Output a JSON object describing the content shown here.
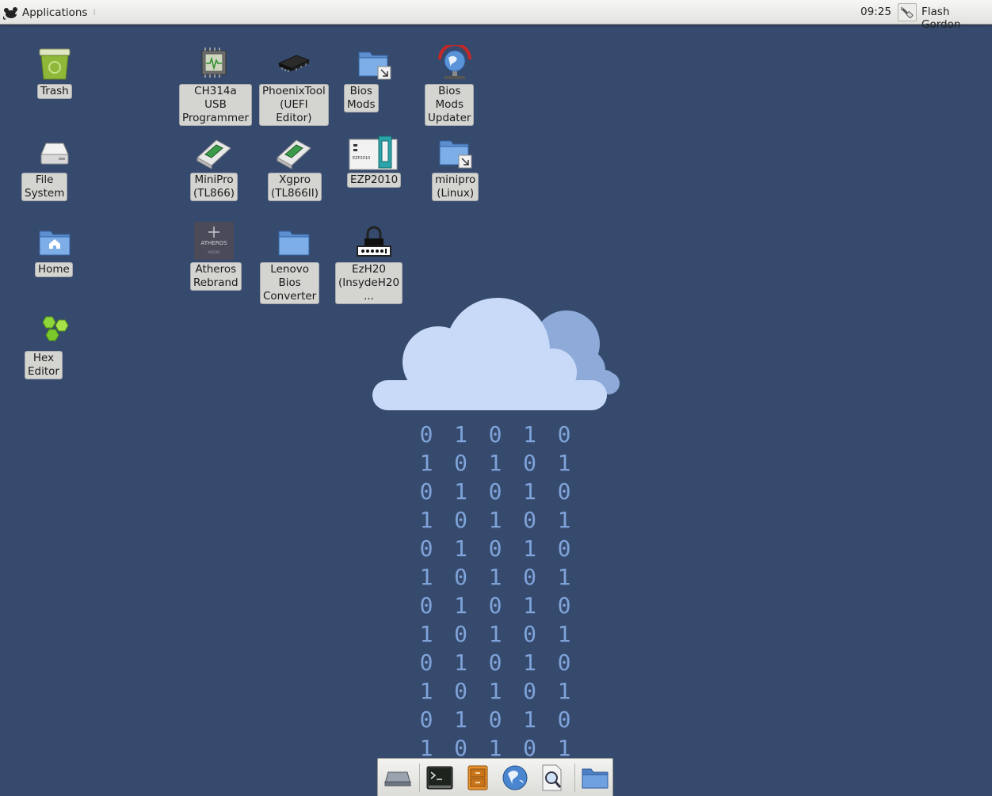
{
  "panel": {
    "applications_label": "Applications",
    "clock": "09:25",
    "user_name": "Flash Gordon"
  },
  "desktop": {
    "trash": "Trash",
    "file_system": "File System",
    "home": "Home",
    "hex_editor": "Hex Editor",
    "ch314a": "CH314a USB\nProgrammer",
    "phoenixtool": "PhoenixTool\n(UEFI Editor)",
    "bios_mods": "Bios Mods",
    "bios_mods_updater": "Bios Mods\nUpdater",
    "minipro_tl866": "MiniPro\n(TL866)",
    "xgpro": "Xgpro\n(TL866II)",
    "ezp2010": "EZP2010",
    "minipro_linux": "minipro\n(Linux)",
    "atheros": "Atheros\nRebrand",
    "lenovo": "Lenovo Bios\nConverter",
    "ezh20": "EzH20\n(InsydeH20 ..."
  },
  "wallpaper": {
    "rows": [
      [
        "0",
        "1",
        "0",
        "1",
        "0"
      ],
      [
        "1",
        "0",
        "1",
        "0",
        "1"
      ],
      [
        "0",
        "1",
        "0",
        "1",
        "0"
      ],
      [
        "1",
        "0",
        "1",
        "0",
        "1"
      ],
      [
        "0",
        "1",
        "0",
        "1",
        "0"
      ],
      [
        "1",
        "0",
        "1",
        "0",
        "1"
      ],
      [
        "0",
        "1",
        "0",
        "1",
        "0"
      ],
      [
        "1",
        "0",
        "1",
        "0",
        "1"
      ],
      [
        "0",
        "1",
        "0",
        "1",
        "0"
      ],
      [
        "1",
        "0",
        "1",
        "0",
        "1"
      ],
      [
        "0",
        "1",
        "0",
        "1",
        "0"
      ],
      [
        "1",
        "0",
        "1",
        "0",
        "1"
      ]
    ]
  },
  "colors": {
    "desktop_bg": "#364a6d",
    "binary_digits": "#7fa3d9",
    "cloud_front": "#c9daf8",
    "cloud_back": "#8eaad8"
  },
  "icons": {
    "dock": [
      "drive-icon",
      "terminal-icon",
      "file-manager-icon",
      "web-browser-icon",
      "search-icon",
      "folder-icon"
    ]
  }
}
